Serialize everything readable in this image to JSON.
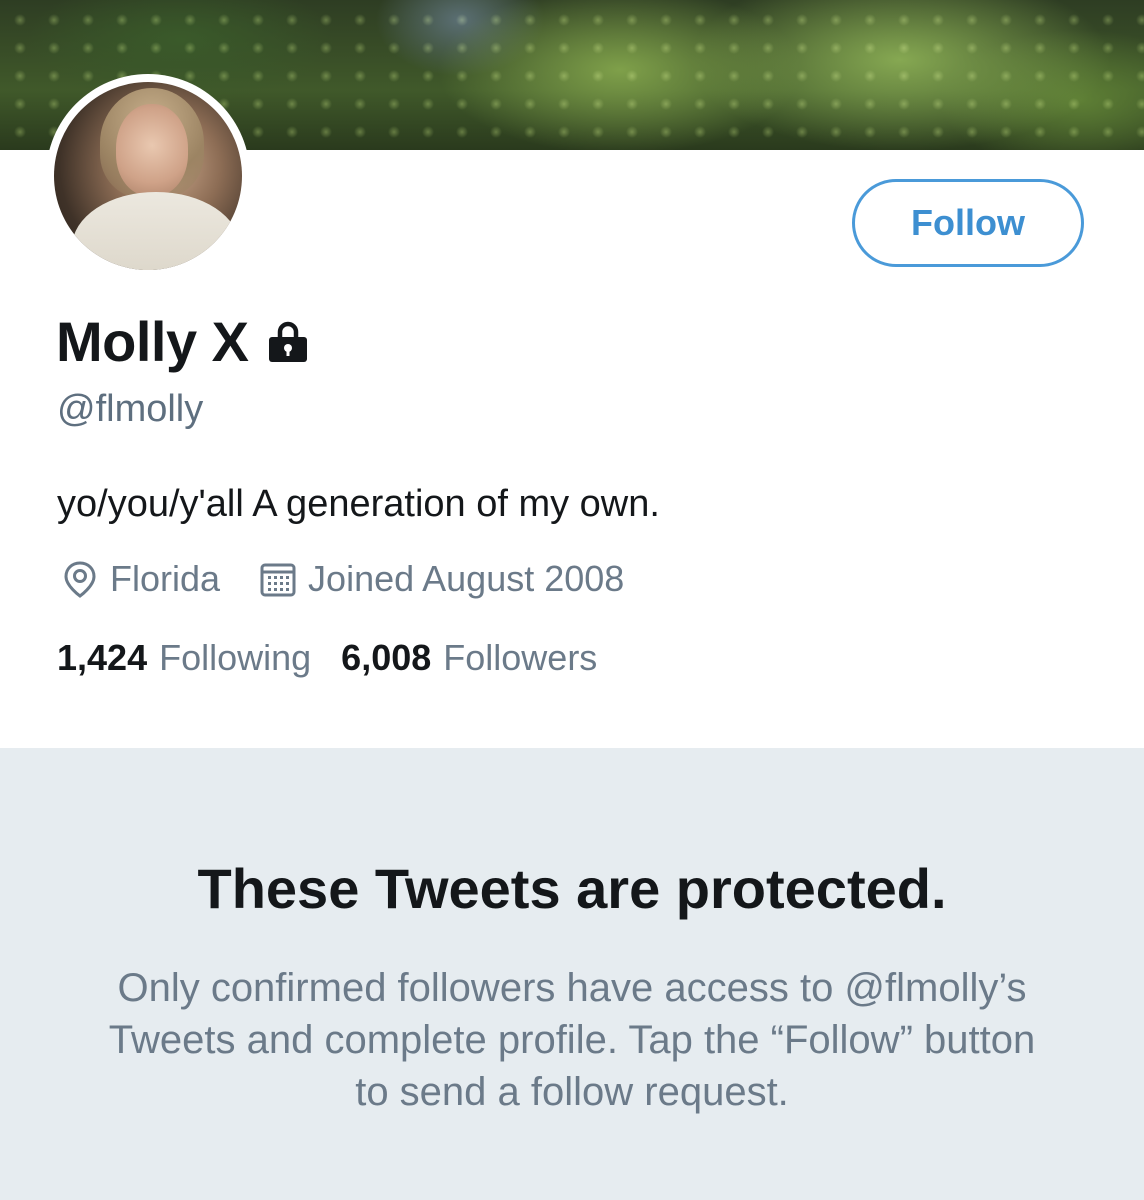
{
  "profile": {
    "name": "Molly X",
    "handle": "@flmolly",
    "bio": "yo/you/y'all A generation of my own.",
    "location": "Florida",
    "joined": "Joined August 2008",
    "following_count": "1,424",
    "following_label": "Following",
    "followers_count": "6,008",
    "followers_label": "Followers",
    "protected_icon": "lock-icon"
  },
  "actions": {
    "follow_label": "Follow"
  },
  "protected": {
    "title": "These Tweets are protected.",
    "message": "Only confirmed followers have access to @flmolly’s Tweets and complete profile. Tap the “Follow” button to send a follow request."
  },
  "colors": {
    "accent": "#3d8fd1",
    "text_primary": "#14171a",
    "text_secondary": "#6b7a89",
    "panel_bg": "#e6ecf0"
  },
  "icons": {
    "location": "location-pin-icon",
    "calendar": "calendar-icon"
  }
}
